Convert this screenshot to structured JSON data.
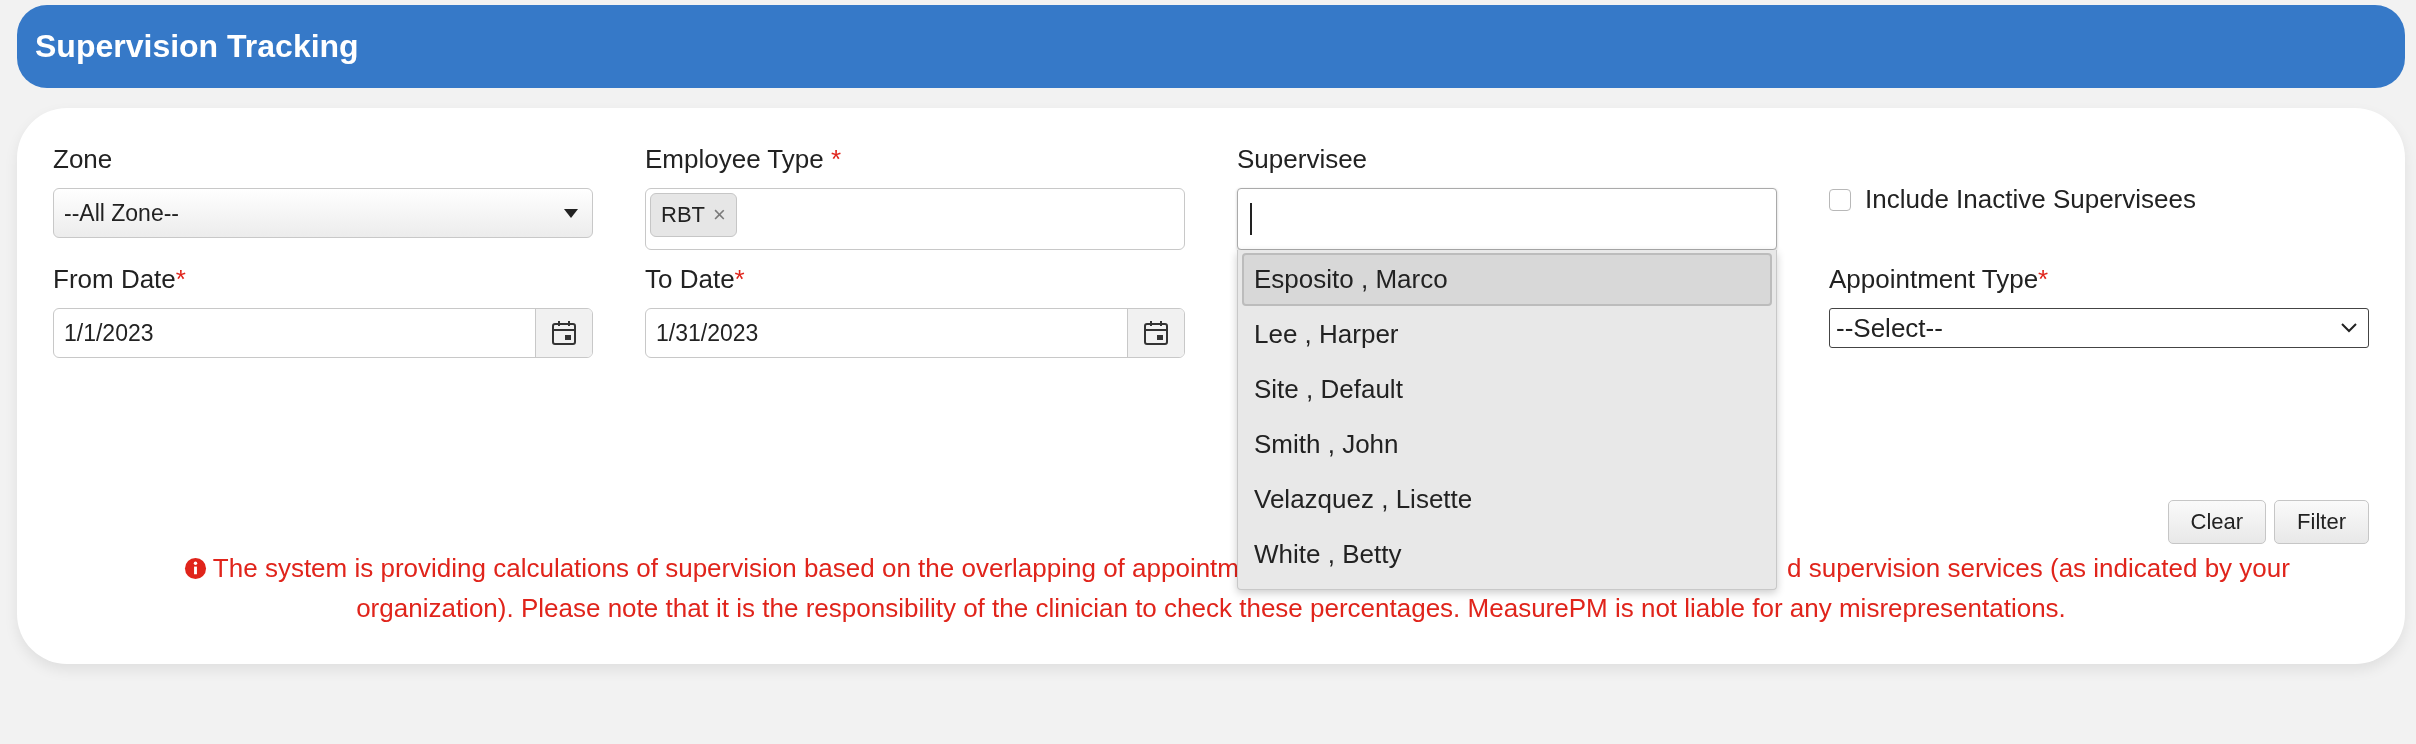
{
  "header": {
    "title": "Supervision Tracking"
  },
  "zone": {
    "label": "Zone",
    "value": "--All Zone--"
  },
  "employee_type": {
    "label": "Employee Type",
    "required_mark": " *",
    "tags": [
      {
        "label": "RBT",
        "remove": "×"
      }
    ]
  },
  "supervisee": {
    "label": "Supervisee",
    "options": [
      {
        "label": "Esposito , Marco",
        "selected": true
      },
      {
        "label": "Lee , Harper",
        "selected": false
      },
      {
        "label": "Site , Default",
        "selected": false
      },
      {
        "label": "Smith , John",
        "selected": false
      },
      {
        "label": "Velazquez , Lisette",
        "selected": false
      },
      {
        "label": "White , Betty",
        "selected": false
      }
    ]
  },
  "include_inactive": {
    "label": "Include Inactive Supervisees",
    "checked": false
  },
  "from_date": {
    "label": "From Date",
    "required_mark": "*",
    "value": "1/1/2023"
  },
  "to_date": {
    "label": "To Date",
    "required_mark": "*",
    "value": "1/31/2023"
  },
  "appointment_type": {
    "label": "Appointment Type",
    "required_mark": "*",
    "value": "--Select--"
  },
  "buttons": [
    "Clear",
    "Filter"
  ],
  "notice": {
    "line_1_left": "The system is providing calculations of supervision based on the overlapping of appointm",
    "line_1_right": "d supervision services (as indicated by your",
    "line_2": "organization). Please note that it is the responsibility of the clinician to check these percentages. MeasurePM is not liable for any misrepresentations."
  }
}
